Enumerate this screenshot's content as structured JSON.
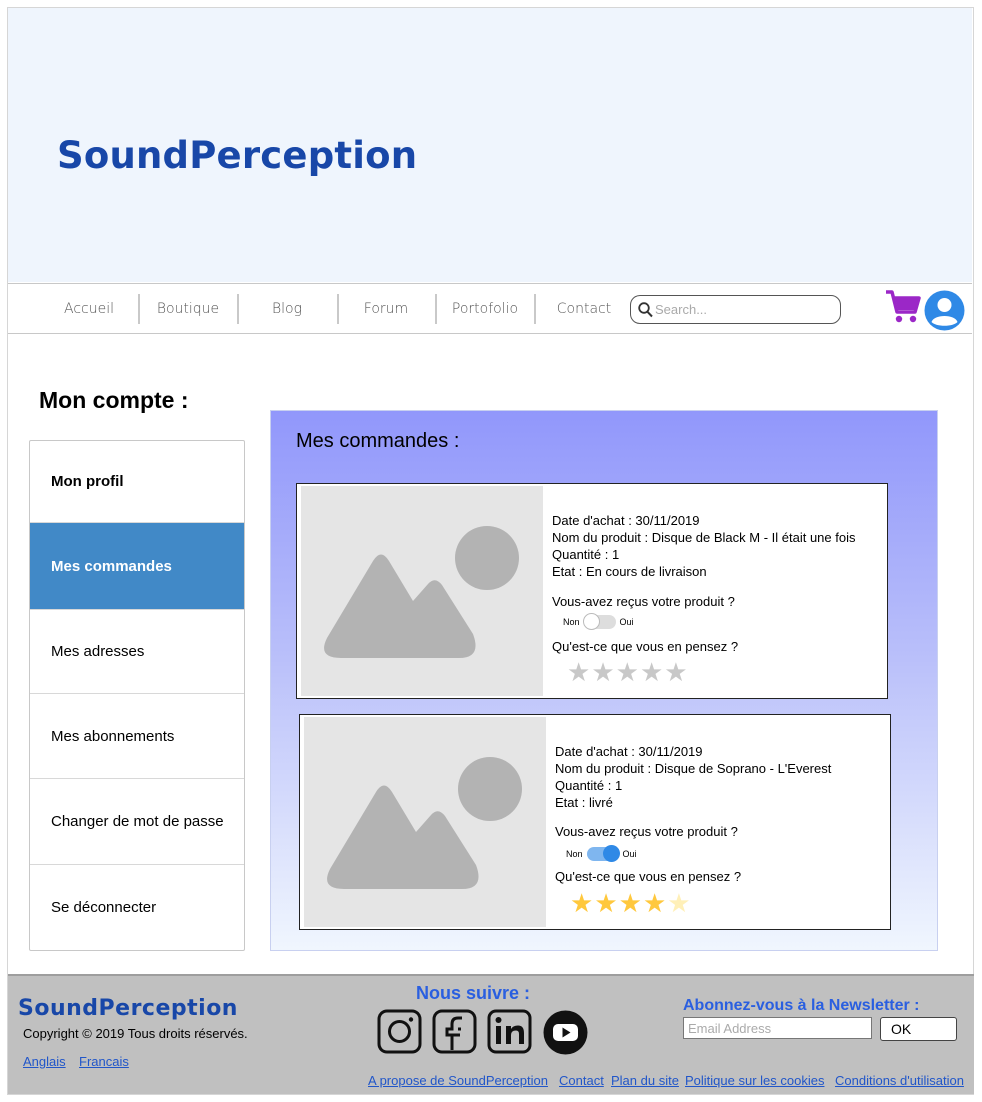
{
  "header": {
    "brand": "SoundPerception"
  },
  "nav": {
    "items": [
      "Accueil",
      "Boutique",
      "Blog",
      "Forum",
      "Portofolio",
      "Contact"
    ],
    "search_placeholder": "Search..."
  },
  "account": {
    "title": "Mon compte :",
    "menu": [
      "Mon profil",
      "Mes commandes",
      "Mes adresses",
      "Mes abonnements",
      "Changer de mot de passe",
      "Se déconnecter"
    ],
    "active_item": "Mes commandes"
  },
  "orders": {
    "title": "Mes commandes :",
    "items": [
      {
        "date": "Date d'achat : 30/11/2019",
        "product": "Nom du produit : Disque de Black M  - Il était une fois",
        "quantity": "Quantité : 1",
        "state": "Etat : En cours de livraison",
        "received_question": "Vous-avez reçus votre produit ?",
        "toggle_off_label": "Non",
        "toggle_on_label": "Oui",
        "received": false,
        "opinion_question": "Qu'est-ce que vous en pensez ?",
        "rating": 0,
        "rating_max": 5
      },
      {
        "date": "Date d'achat : 30/11/2019",
        "product": "Nom du produit : Disque de Soprano - L'Everest",
        "quantity": "Quantité : 1",
        "state": "Etat : livré",
        "received_question": "Vous-avez reçus votre produit ?",
        "toggle_off_label": "Non",
        "toggle_on_label": "Oui",
        "received": true,
        "opinion_question": "Qu'est-ce que vous en pensez ?",
        "rating": 4,
        "rating_max": 5
      }
    ]
  },
  "footer": {
    "brand": "SoundPerception",
    "copyright": "Copyright © 2019 Tous droits réservés.",
    "languages": [
      "Anglais",
      "Francais"
    ],
    "follow_title": "Nous suivre :",
    "social_icons": [
      "instagram-icon",
      "facebook-icon",
      "linkedin-icon",
      "youtube-icon"
    ],
    "newsletter_title": "Abonnez-vous à la Newsletter :",
    "email_placeholder": "Email Address",
    "ok_label": "OK",
    "links": [
      "A propose de SoundPerception",
      "Contact",
      "Plan du site",
      "Politique sur les cookies",
      "Conditions d'utilisation"
    ]
  },
  "colors": {
    "brand": "#1847a8",
    "active_menu": "#4189c7",
    "cart": "#9b27c7",
    "user": "#2f89e6",
    "star_on": "#ffc83d",
    "star_off": "#c8c8c8",
    "link": "#2156c9"
  }
}
